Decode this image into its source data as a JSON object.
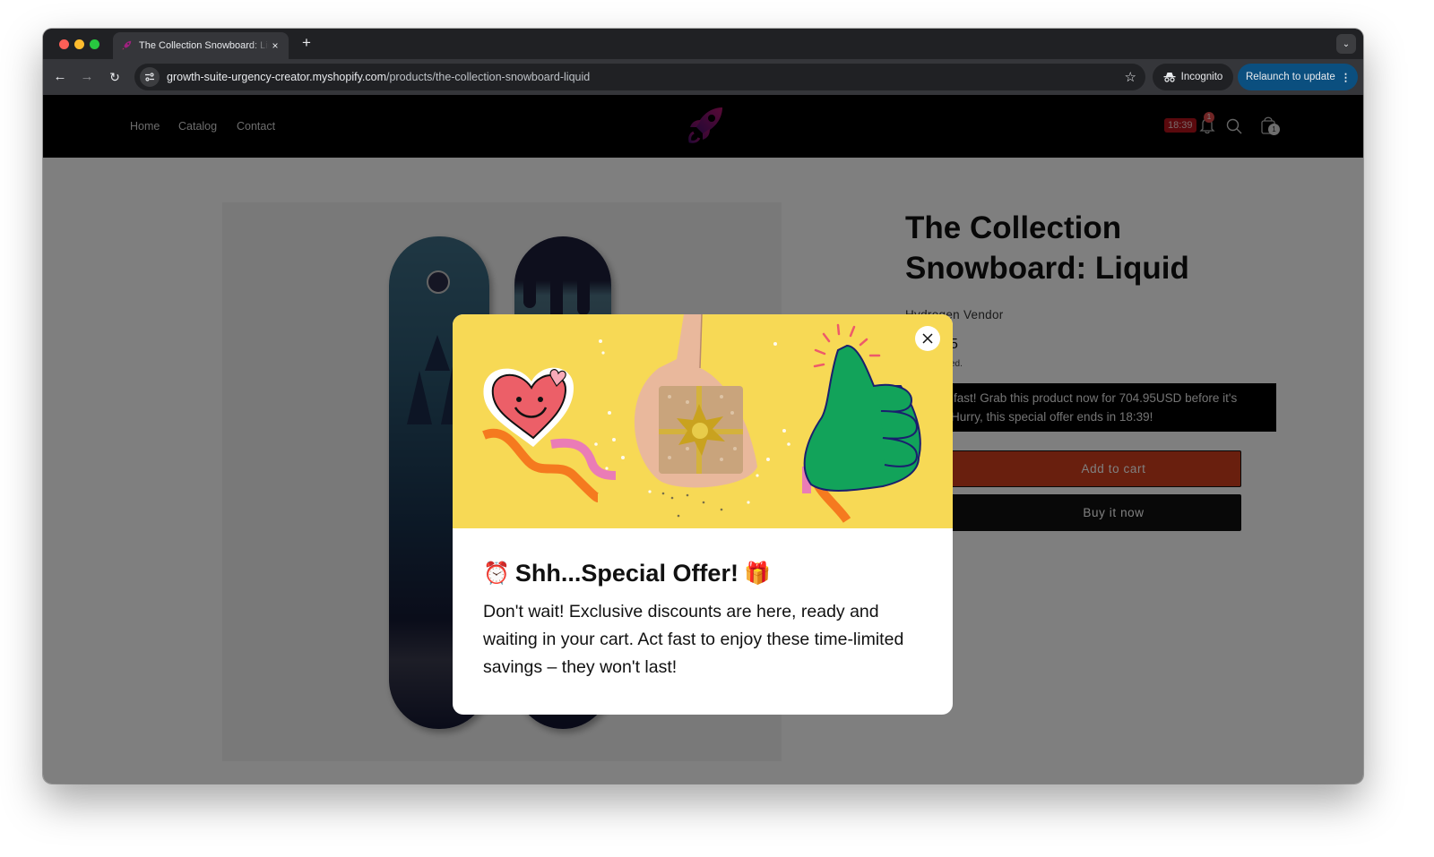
{
  "browser": {
    "tab_title": "The Collection Snowboard: Liquid",
    "tab_close": "×",
    "new_tab": "+",
    "url_host": "growth-suite-urgency-creator.myshopify.com",
    "url_path": "/products/the-collection-snowboard-liquid",
    "incognito_label": "Incognito",
    "relaunch_label": "Relaunch to update",
    "icons": {
      "back": "←",
      "forward": "→",
      "reload": "↻",
      "star": "☆",
      "menu": "⋮",
      "tab_list": "⌄"
    }
  },
  "store": {
    "nav": [
      {
        "label": "Home"
      },
      {
        "label": "Catalog"
      },
      {
        "label": "Contact"
      }
    ],
    "timer_badge": "18:39",
    "notification_count": "1",
    "cart_count": "1",
    "brand_color": "#8b1a7a"
  },
  "product": {
    "title": "The Collection Snowboard: Liquid",
    "vendor": "Hydrogen Vendor",
    "price_visible": "5",
    "tax_note_visible": "ed.",
    "urgency_line1": "fast! Grab this product now for 704.95USD before it's",
    "urgency_line2": "Hurry, this special offer ends in 18:39!",
    "add_to_cart": "Add to cart",
    "buy_now": "Buy it now"
  },
  "modal": {
    "title_emoji_left": "⏰",
    "title": "Shh...Special Offer!",
    "title_emoji_right": "🎁",
    "text": "Don't wait! Exclusive discounts are here, ready and waiting in your cart. Act fast to enjoy these time-limited savings – they won't last!",
    "close_label": "×"
  }
}
